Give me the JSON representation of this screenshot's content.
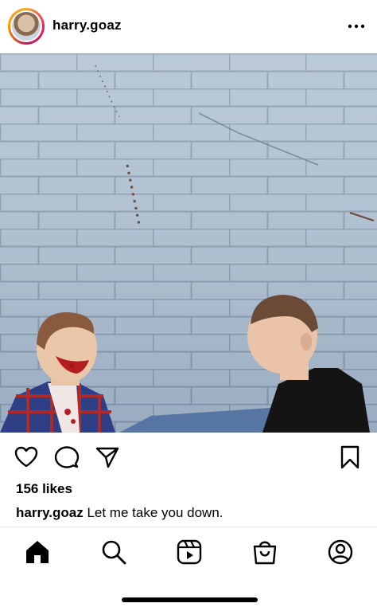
{
  "post": {
    "username": "harry.goaz",
    "likes_text": "156 likes",
    "caption": {
      "username": "harry.goaz",
      "text": "Let me take you down."
    }
  },
  "icons": {
    "header": [
      "avatar",
      "more-options-icon"
    ],
    "actions": [
      "heart-icon",
      "comment-icon",
      "share-icon",
      "bookmark-icon"
    ],
    "nav": [
      "home-icon",
      "search-icon",
      "reels-icon",
      "shop-icon",
      "profile-icon"
    ]
  },
  "colors": {
    "text": "#000000",
    "background": "#ffffff",
    "divider": "#e6e6e6"
  }
}
